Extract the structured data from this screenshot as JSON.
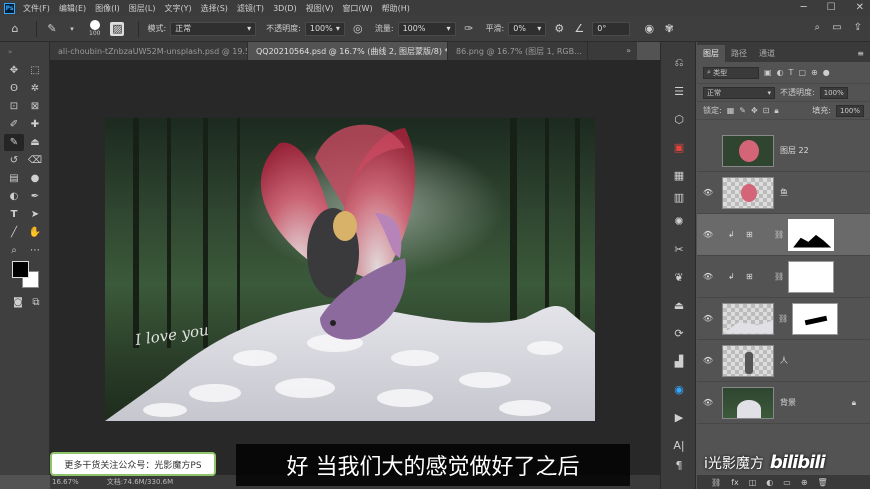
{
  "menu": {
    "items": [
      "文件(F)",
      "编辑(E)",
      "图像(I)",
      "图层(L)",
      "文字(Y)",
      "选择(S)",
      "滤镜(T)",
      "3D(D)",
      "视图(V)",
      "窗口(W)",
      "帮助(H)"
    ]
  },
  "options": {
    "brush_size": "100",
    "mode_label": "模式:",
    "mode_value": "正常",
    "opacity_label": "不透明度:",
    "opacity_value": "100%",
    "flow_label": "流量:",
    "flow_value": "100%",
    "smoothing_label": "平滑:",
    "smoothing_value": "0%",
    "angle_value": "0°"
  },
  "tabs": [
    {
      "label": "ali-choubin-tZnbzaUW52M-unsplash.psd @ 19.5% (图层 2...",
      "active": false
    },
    {
      "label": "QQ20210564.psd @ 16.7% (曲线 2, 图层蒙版/8) *",
      "active": true
    },
    {
      "label": "86.png @ 16.7% (图层 1, RGB...",
      "active": false
    }
  ],
  "canvas": {
    "signature": "I love you"
  },
  "status": {
    "zoom": "16.67%",
    "doc": "文档:74.6M/330.6M"
  },
  "panel": {
    "tabs": [
      "图层",
      "路径",
      "通道"
    ],
    "filter_kind": "类型",
    "blend_mode": "正常",
    "opacity_label": "不透明度:",
    "opacity_value": "100%",
    "lock_label": "锁定:",
    "fill_label": "填充:",
    "fill_value": "100%",
    "layers": [
      {
        "name": "图层 22"
      },
      {
        "name": "鱼"
      },
      {
        "name": ""
      },
      {
        "name": ""
      },
      {
        "name": ""
      },
      {
        "name": "人"
      },
      {
        "name": "背景"
      }
    ]
  },
  "overlay": {
    "promo": "更多干货关注公众号：光影魔方PS",
    "subtitle": "好 当我们大的感觉做好了之后",
    "watermark": "i光影魔方",
    "bili": "bilibili"
  },
  "colors": {
    "accent": "#31a8ff",
    "foreground": "#000000",
    "background": "#ffffff",
    "promo_border": "#8fc46a"
  }
}
